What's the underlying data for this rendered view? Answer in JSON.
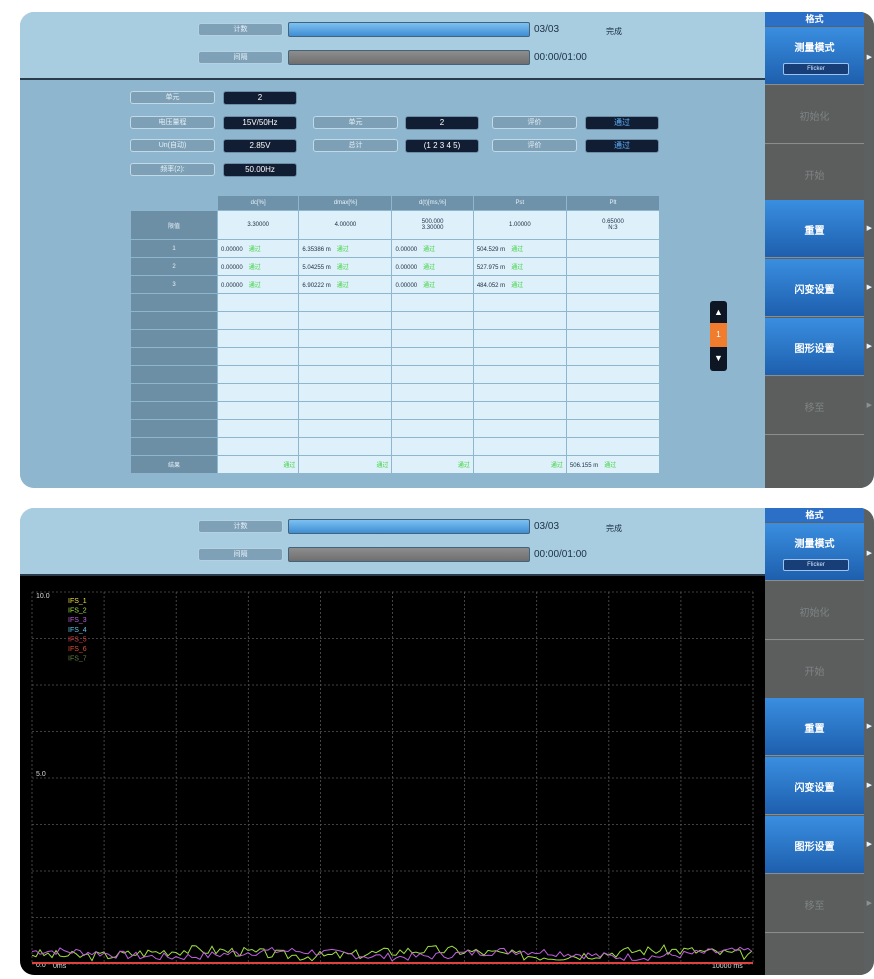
{
  "status": {
    "count_label": "计数",
    "interval_label": "间隔",
    "count_value": "03/03",
    "count_progress": 1.0,
    "interval_value": "00:00/01:00",
    "state": "完成"
  },
  "params": {
    "unit_label": "单元",
    "unit_value": "2",
    "range_label": "电压量程",
    "range_value": "15V/50Hz",
    "unit2_label": "单元",
    "unit2_value": "2",
    "eval1_label": "评价",
    "eval1_value": "通过",
    "un_label": "Un(自动)",
    "un_value": "2.85V",
    "total_label": "总计",
    "total_value": "(1 2 3 4 5)",
    "eval2_label": "评价",
    "eval2_value": "通过",
    "freq_label": "频率(2):",
    "freq_value": "50.00Hz"
  },
  "table": {
    "headers": [
      "dc[%]",
      "dmax[%]",
      "d(t)[ms,%]",
      "Pst",
      "Plt"
    ],
    "limit_label": "限值",
    "limits": [
      "3.30000",
      "4.00000",
      "500.000",
      "1.00000",
      "0.65000"
    ],
    "limits_line2": [
      "",
      "",
      "3.30000",
      "",
      "N:3"
    ],
    "rows": [
      {
        "label": "1",
        "cells": [
          "0.00000",
          "6.35386 m",
          "0.00000",
          "504.529 m",
          ""
        ]
      },
      {
        "label": "2",
        "cells": [
          "0.00000",
          "5.04255 m",
          "0.00000",
          "527.975 m",
          ""
        ]
      },
      {
        "label": "3",
        "cells": [
          "0.00000",
          "6.90222 m",
          "0.00000",
          "484.052 m",
          ""
        ]
      }
    ],
    "pass": "通过",
    "result_label": "结果",
    "result_plt": "506.155 m"
  },
  "pager": {
    "page": "1"
  },
  "sidebar": {
    "header": "格式",
    "mode_label": "测量模式",
    "mode_value": "Flicker",
    "init": "初始化",
    "start": "开始",
    "reset": "重置",
    "flicker_settings": "闪变设置",
    "graph_settings": "图形设置",
    "shift": "移至"
  },
  "chart_data": {
    "type": "line",
    "y_ticks": [
      "10.0",
      "5.0",
      "0.0"
    ],
    "ylim": [
      0,
      10
    ],
    "x_start_label": "0ms",
    "x_end_label": "10000 ms",
    "grid": true,
    "legend_position": "top-left",
    "series": [
      {
        "name": "IFS_1",
        "color": "#f0e040"
      },
      {
        "name": "IFS_2",
        "color": "#a0e040"
      },
      {
        "name": "IFS_3",
        "color": "#c060e0"
      },
      {
        "name": "IFS_4",
        "color": "#60c8f0"
      },
      {
        "name": "IFS_5",
        "color": "#e04040"
      },
      {
        "name": "IFS_6",
        "color": "#e05030"
      },
      {
        "name": "IFS_7",
        "color": "#608040"
      }
    ]
  }
}
